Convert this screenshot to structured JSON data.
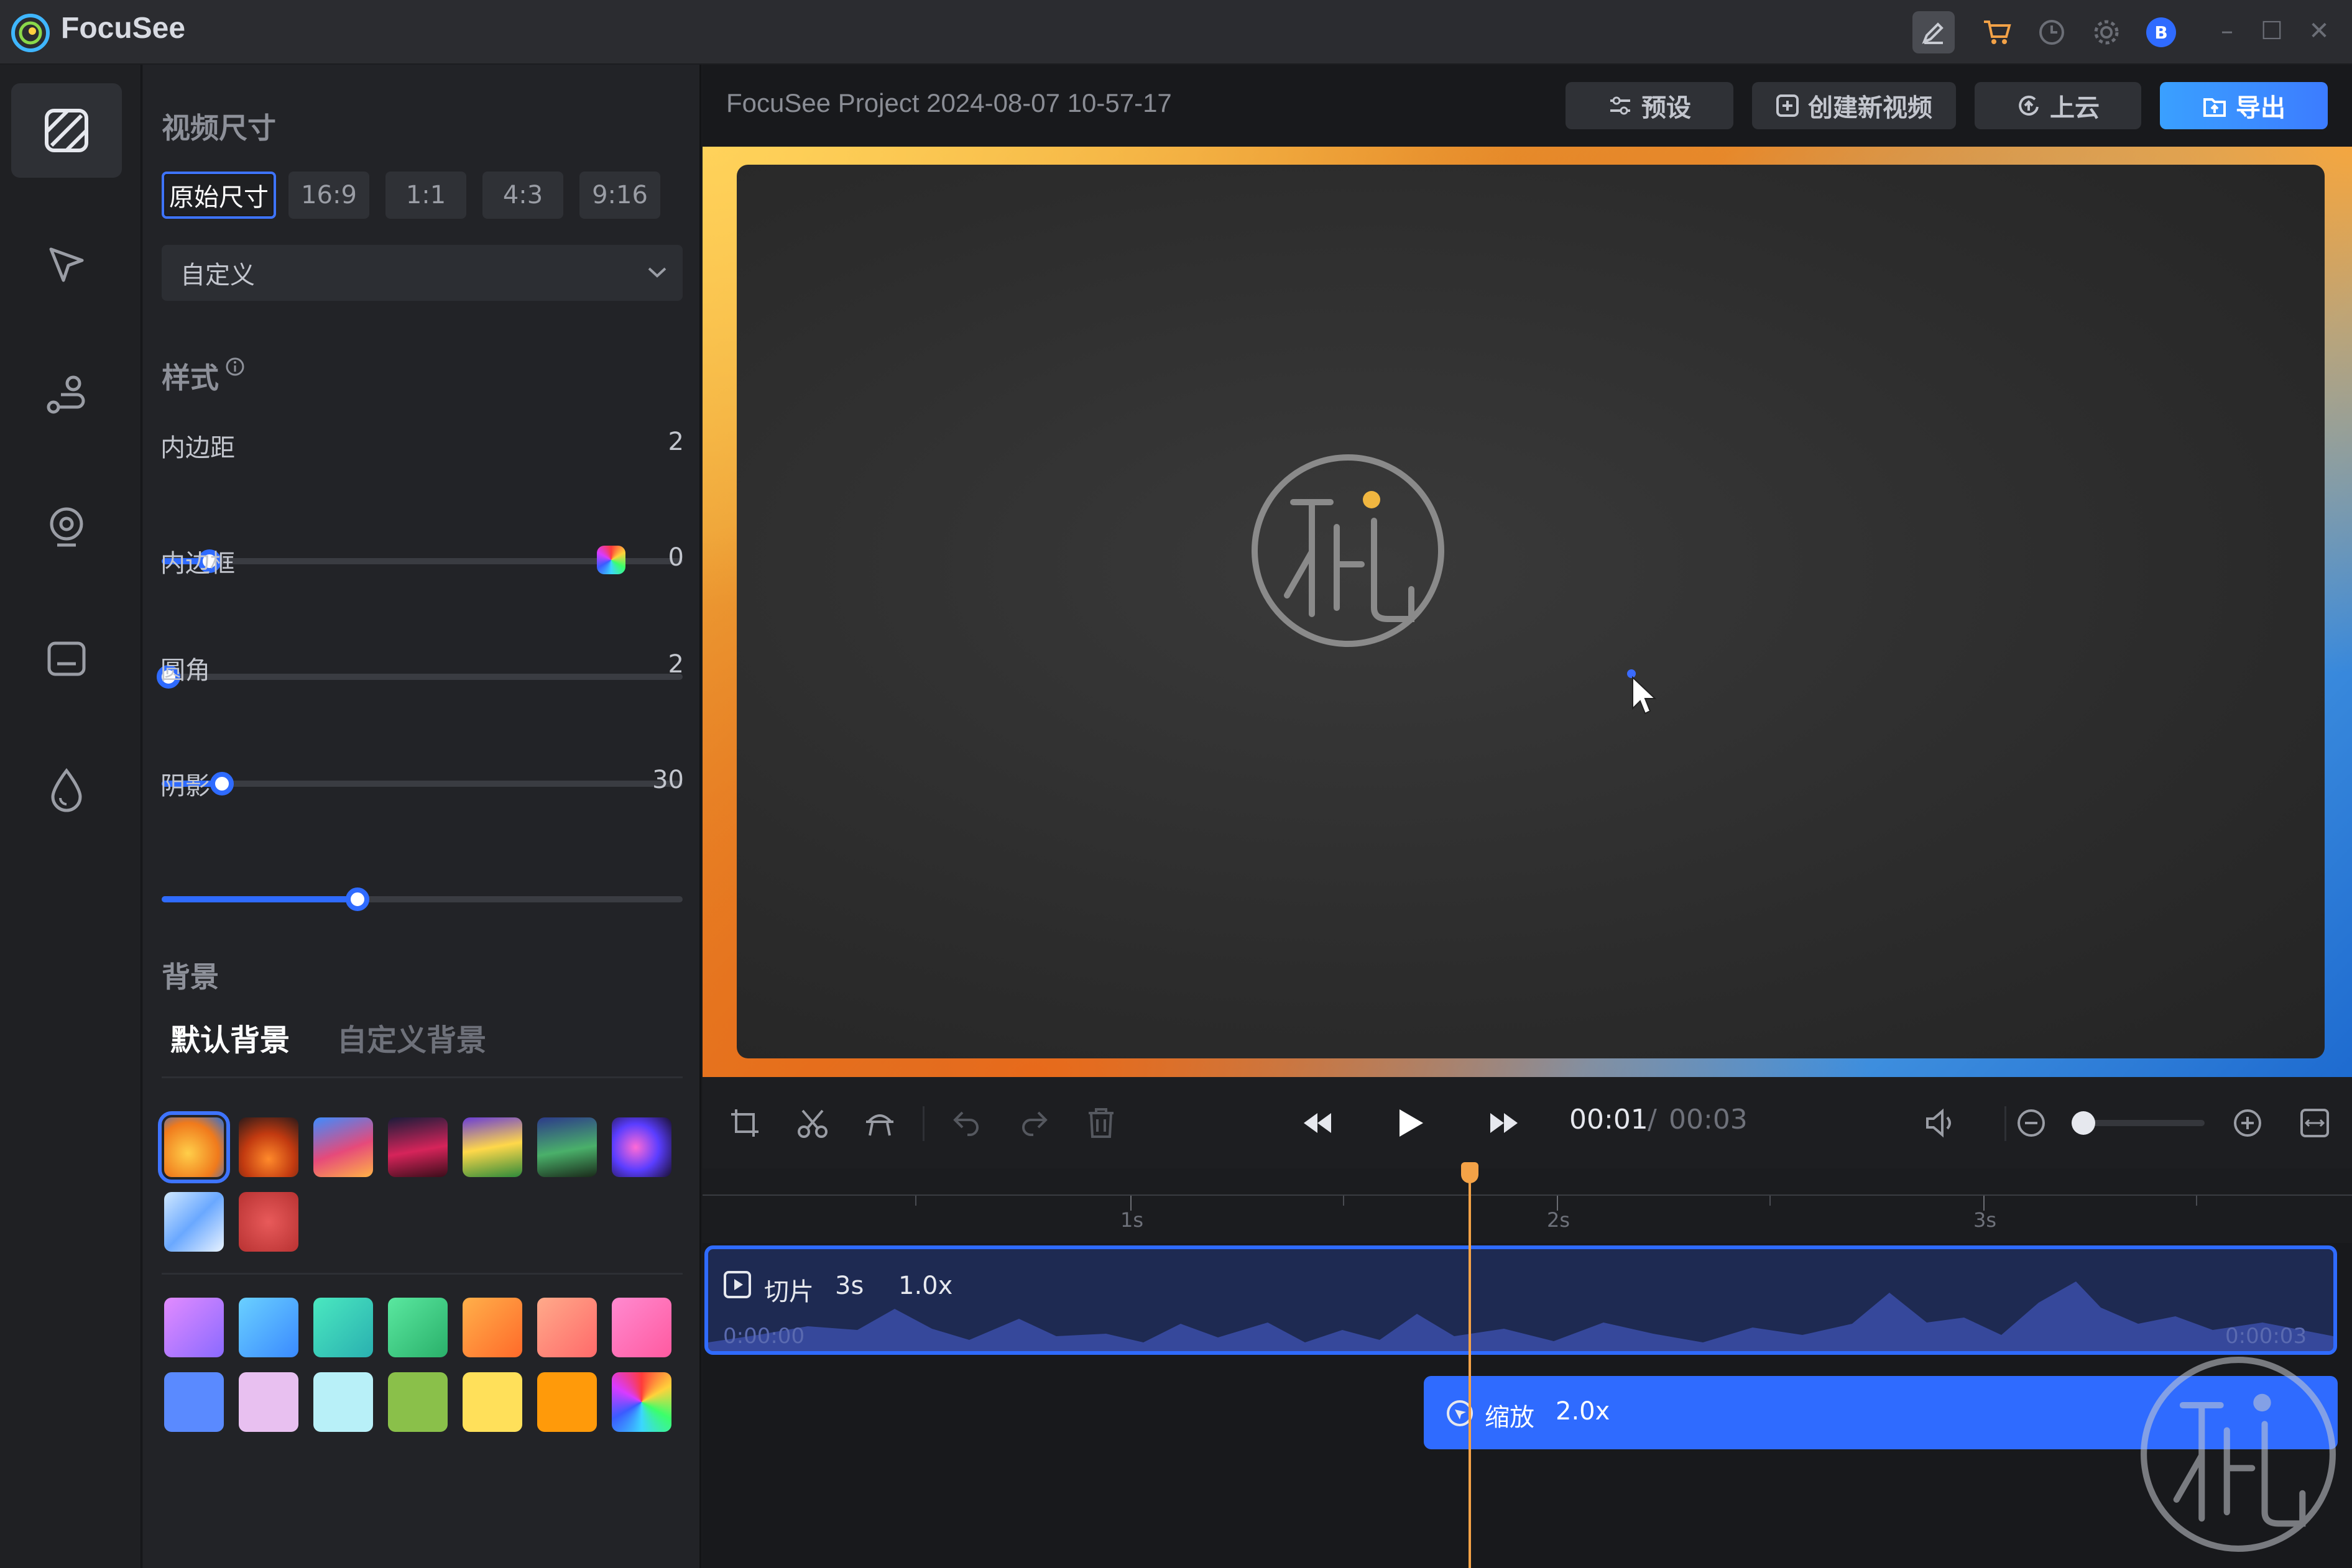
{
  "app": {
    "name": "FocuSee"
  },
  "titlebar": {
    "icons": [
      "pen-icon",
      "cart-icon",
      "clock-icon",
      "gear-icon",
      "avatar"
    ],
    "avatar_letter": "B"
  },
  "rail": {
    "items": [
      "background-icon",
      "cursor-icon",
      "path-icon",
      "webcam-icon",
      "caption-icon",
      "watermark-icon"
    ]
  },
  "panel": {
    "video_size_title": "视频尺寸",
    "ratios": [
      "原始尺寸",
      "16:9",
      "1:1",
      "4:3",
      "9:16"
    ],
    "size_select": "自定义",
    "style_title": "样式",
    "sliders": [
      {
        "label": "内边距",
        "value": "2",
        "fraction": 0.1
      },
      {
        "label": "内边框",
        "value": "0",
        "fraction": 0.02
      },
      {
        "label": "圆角",
        "value": "2",
        "fraction": 0.12
      },
      {
        "label": "阴影",
        "value": "30",
        "fraction": 0.38
      }
    ],
    "bg_title": "背景",
    "bg_tabs": [
      "默认背景",
      "自定义背景"
    ]
  },
  "header": {
    "project_title": "FocuSee Project 2024-08-07 10-57-17",
    "buttons": {
      "preset": "预设",
      "new_video": "创建新视频",
      "cloud": "上云",
      "export": "导出"
    }
  },
  "player": {
    "current": "00:01",
    "separator": "/",
    "total": "00:03"
  },
  "timeline": {
    "ticks": [
      "1s",
      "2s",
      "3s"
    ],
    "clip": {
      "label": "切片",
      "duration": "3s",
      "speed": "1.0x",
      "start": "0:00:00",
      "end": "0:00:03"
    },
    "zoom": {
      "label": "缩放",
      "factor": "2.0x"
    }
  },
  "colors": {
    "accent": "#2f6bff",
    "playhead": "#f3a247",
    "export_gradient": [
      "#3aa0ff",
      "#3c7cff"
    ]
  }
}
